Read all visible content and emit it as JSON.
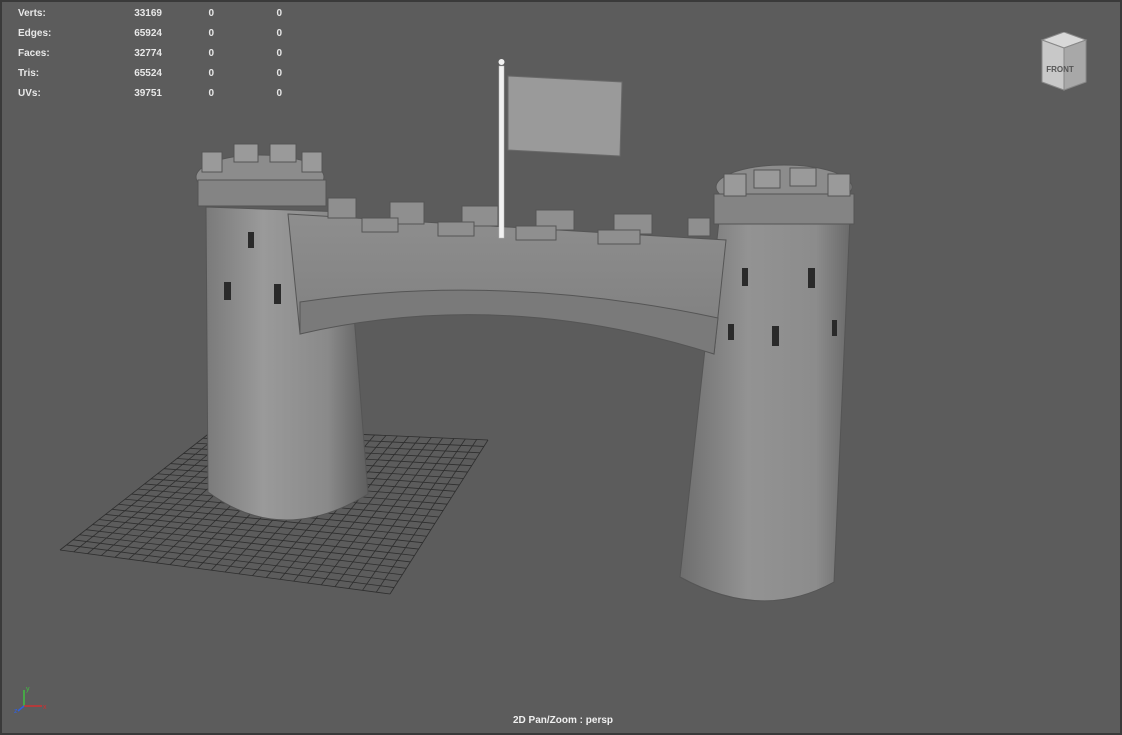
{
  "heads_up": {
    "rows": [
      {
        "label": "Verts:",
        "values": [
          "33169",
          "0",
          "0"
        ]
      },
      {
        "label": "Edges:",
        "values": [
          "65924",
          "0",
          "0"
        ]
      },
      {
        "label": "Faces:",
        "values": [
          "32774",
          "0",
          "0"
        ]
      },
      {
        "label": "Tris:",
        "values": [
          "65524",
          "0",
          "0"
        ]
      },
      {
        "label": "UVs:",
        "values": [
          "39751",
          "0",
          "0"
        ]
      }
    ]
  },
  "view_cube": {
    "face_label": "FRONT"
  },
  "camera_label": "2D Pan/Zoom : persp",
  "axis_indicator": {
    "y": "y",
    "z": "z",
    "x": "x"
  },
  "colors": {
    "viewport_bg": "#5c5c5c",
    "model": "#8a8a8a",
    "grid": "#2a2a2a",
    "axis_x": "#d03030",
    "axis_y": "#40c040",
    "axis_z": "#3060e0"
  }
}
